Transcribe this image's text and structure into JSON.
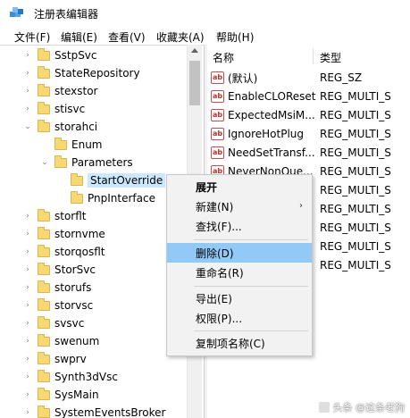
{
  "window": {
    "title": "注册表编辑器"
  },
  "menu": [
    "文件(F)",
    "编辑(E)",
    "查看(V)",
    "收藏夹(A)",
    "帮助(H)"
  ],
  "tree": [
    {
      "label": "SstpSvc",
      "chev": "›"
    },
    {
      "label": "StateRepository",
      "chev": "›"
    },
    {
      "label": "stexstor",
      "chev": "›"
    },
    {
      "label": "stisvc",
      "chev": "›"
    },
    {
      "label": "storahci",
      "chev": "⌄"
    },
    {
      "label": "Enum",
      "chev": ""
    },
    {
      "label": "Parameters",
      "chev": "⌄"
    },
    {
      "label": "StartOverride",
      "chev": ""
    },
    {
      "label": "PnpInterface",
      "chev": ""
    },
    {
      "label": "storflt",
      "chev": "›"
    },
    {
      "label": "stornvme",
      "chev": "›"
    },
    {
      "label": "storqosflt",
      "chev": "›"
    },
    {
      "label": "StorSvc",
      "chev": "›"
    },
    {
      "label": "storufs",
      "chev": "›"
    },
    {
      "label": "storvsc",
      "chev": "›"
    },
    {
      "label": "svsvc",
      "chev": "›"
    },
    {
      "label": "swenum",
      "chev": "›"
    },
    {
      "label": "swprv",
      "chev": "›"
    },
    {
      "label": "Synth3dVsc",
      "chev": "›"
    },
    {
      "label": "SysMain",
      "chev": "›"
    },
    {
      "label": "SystemEventsBroker",
      "chev": "›"
    }
  ],
  "list": {
    "headers": {
      "name": "名称",
      "type": "类型"
    },
    "rows": [
      {
        "icon": "ab",
        "name": "(默认)",
        "type": "REG_SZ"
      },
      {
        "icon": "ab",
        "name": "EnableCLOReset",
        "type": "REG_MULTI_S"
      },
      {
        "icon": "ab",
        "name": "ExpectedMsiM...",
        "type": "REG_MULTI_S"
      },
      {
        "icon": "ab",
        "name": "IgnoreHotPlug",
        "type": "REG_MULTI_S"
      },
      {
        "icon": "ab",
        "name": "NeedSetTransf...",
        "type": "REG_MULTI_S"
      },
      {
        "icon": "ab",
        "name": "NeverNonQue...",
        "type": "REG_MULTI_S"
      },
      {
        "icon": "",
        "name": "",
        "type": "REG_MULTI_S"
      },
      {
        "icon": "",
        "name": "",
        "type": "REG_MULTI_S"
      },
      {
        "icon": "",
        "name": "",
        "type": "REG_MULTI_S"
      },
      {
        "icon": "",
        "name": "",
        "type": "REG_MULTI_S"
      },
      {
        "icon": "",
        "name": "",
        "type": "REG_MULTI_S"
      }
    ]
  },
  "context_menu": {
    "expand": "展开",
    "new": "新建(N)",
    "find": "查找(F)...",
    "delete": "删除(D)",
    "rename": "重命名(R)",
    "export": "导出(E)",
    "permissions": "权限(P)...",
    "copy_key_name": "复制项名称(C)",
    "submenu_arrow": "›"
  },
  "watermark": {
    "text": "头条 @这条老狗"
  }
}
